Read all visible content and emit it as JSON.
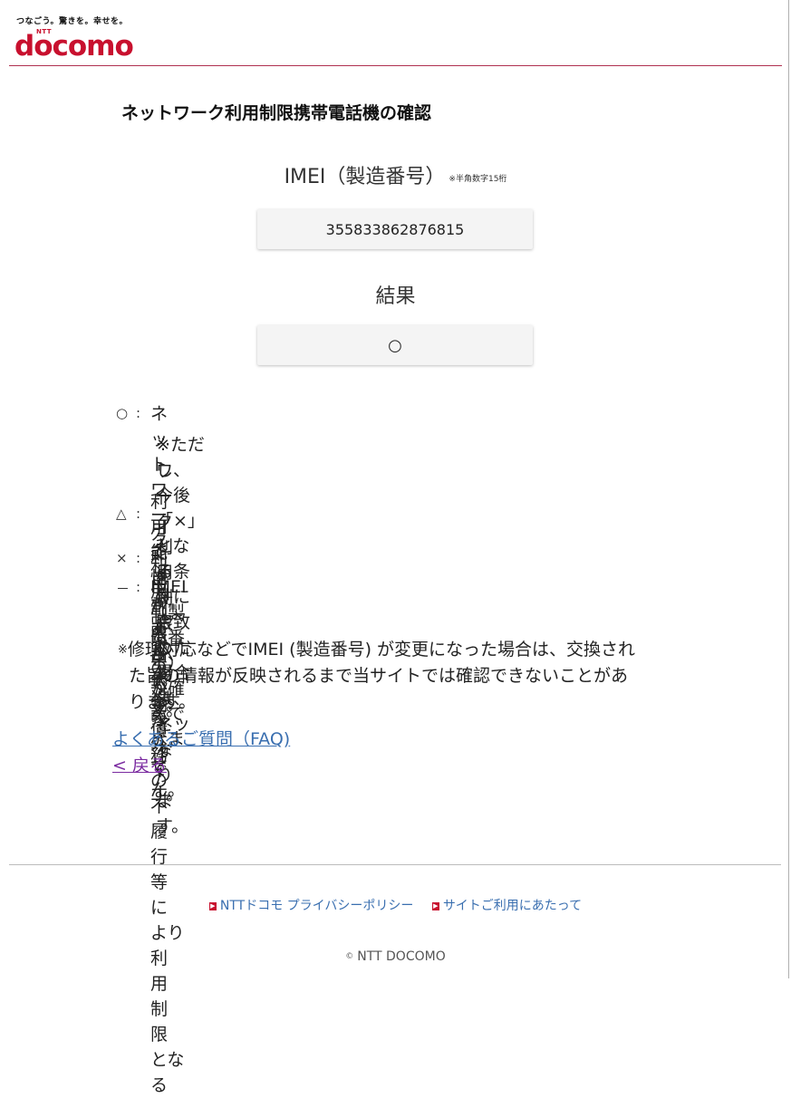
{
  "header": {
    "tagline": "つなごう。驚きを。幸せを。",
    "logo_ntt": "NTT",
    "logo_word": "docomo"
  },
  "page": {
    "title": "ネットワーク利用制限携帯電話機の確認"
  },
  "imei": {
    "label": "IMEI（製造番号）",
    "note": "※半角数字15桁",
    "value": "355833862876815"
  },
  "result": {
    "label": "結果",
    "value": "○"
  },
  "legend": {
    "circle_symbol": "○",
    "circle_line1": "ネットワーク利用制限の対象外です。",
    "circle_line2": "※ただし、今後「×」となる条件に合致した場合は、ネット",
    "circle_line3": "ワーク利用制限の対象となります。",
    "triangle_symbol": "△",
    "triangle_line1": "利用できますが、代金債務の不履行等により利用制限となる",
    "triangle_line2": "可能性があります。",
    "cross_symbol": "×",
    "cross_text": "利用制限中です。",
    "dash_symbol": "－",
    "dash_text": "IMEI（製造番号）が確認できません。",
    "colon": ":"
  },
  "notice": {
    "mark": "※",
    "line1": "修理対応などでIMEI (製造番号) が変更になった場合は、交換され",
    "line2": "た旨の情報が反映されるまで当サイトでは確認できないことがあ",
    "line3": "ります。"
  },
  "links": {
    "faq": "よくあるご質問（FAQ)",
    "back": "< 戻る"
  },
  "footer": {
    "link_privacy": "NTTドコモ プライバシーポリシー",
    "link_terms": "サイトご利用にあたって",
    "copyright_mark": "©",
    "copyright_text": "NTT DOCOMO"
  },
  "colors": {
    "brand_red": "#c8102e",
    "link_blue": "#3a6fb0",
    "visited_purple": "#7a2aa0"
  }
}
